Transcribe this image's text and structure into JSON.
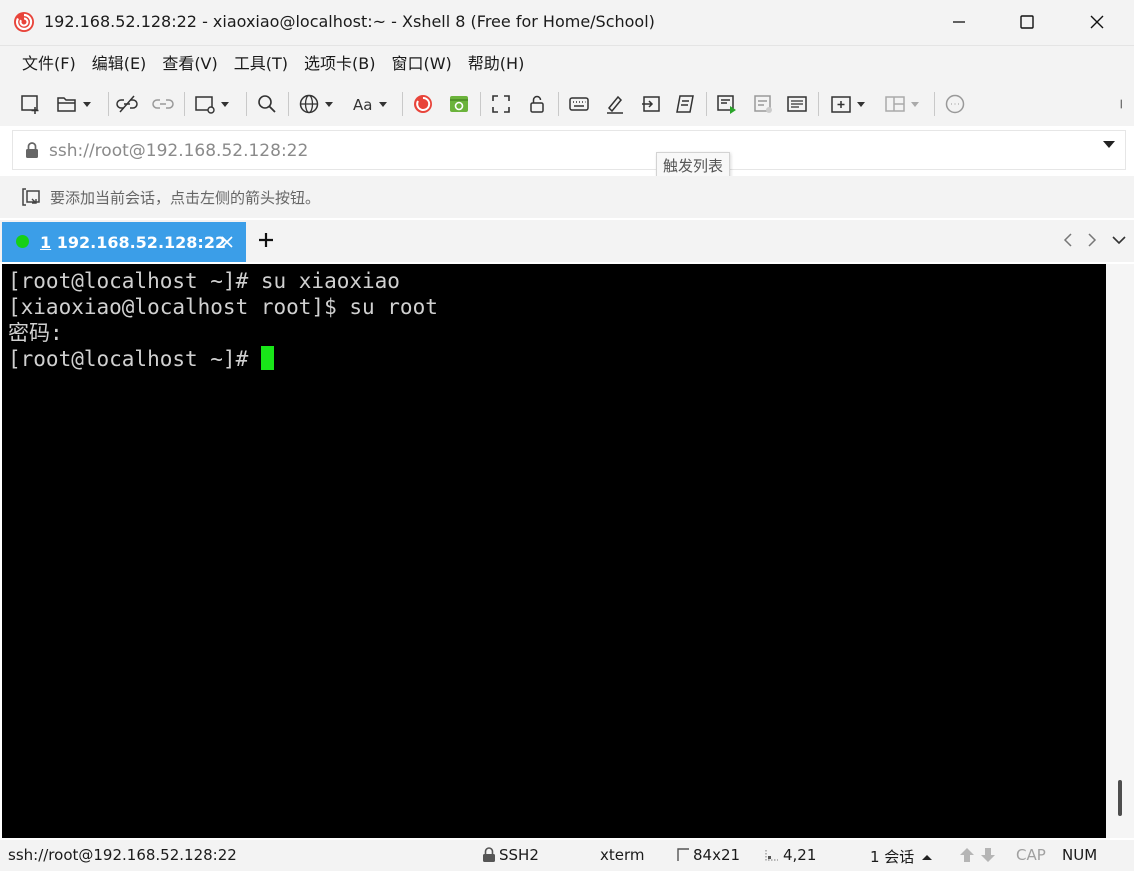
{
  "window": {
    "title": "192.168.52.128:22 - xiaoxiao@localhost:~ - Xshell 8 (Free for Home/School)"
  },
  "menu": {
    "items": [
      "文件(F)",
      "编辑(E)",
      "查看(V)",
      "工具(T)",
      "选项卡(B)",
      "窗口(W)",
      "帮助(H)"
    ]
  },
  "address": {
    "value": "ssh://root@192.168.52.128:22",
    "tooltip": "触发列表"
  },
  "session_bar": {
    "hint": "要添加当前会话，点击左侧的箭头按钮。"
  },
  "tabs": [
    {
      "number": "1",
      "label": "192.168.52.128:22",
      "status_color": "#17d017"
    }
  ],
  "terminal": {
    "lines": [
      "[root@localhost ~]# su xiaoxiao",
      "[xiaoxiao@localhost root]$ su root",
      "密码:",
      "[root@localhost ~]# "
    ],
    "cursor_color": "#19e619"
  },
  "status": {
    "connection": "ssh://root@192.168.52.128:22",
    "protocol": "SSH2",
    "terminal_type": "xterm",
    "size": "84x21",
    "cursor_pos": "4,21",
    "sessions": "1 会话",
    "cap": "CAP",
    "num": "NUM"
  },
  "colors": {
    "accent": "#3b9ee8",
    "terminal_bg": "#000000",
    "chrome_bg": "#f3f3f3"
  }
}
